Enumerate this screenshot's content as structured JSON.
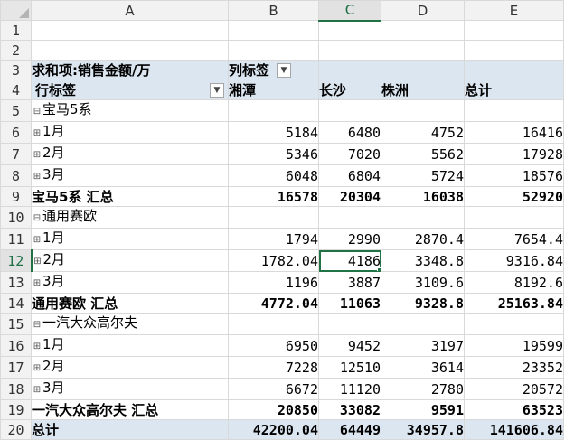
{
  "columns": [
    "A",
    "B",
    "C",
    "D",
    "E"
  ],
  "rows_numbers": [
    "1",
    "2",
    "3",
    "4",
    "5",
    "6",
    "7",
    "8",
    "9",
    "10",
    "11",
    "12",
    "13",
    "14",
    "15",
    "16",
    "17",
    "18",
    "19",
    "20"
  ],
  "pivot": {
    "value_label": "求和项:销售金额/万",
    "col_label": "列标签",
    "row_label": "行标签",
    "cities": [
      "湘潭",
      "长沙",
      "株洲"
    ],
    "total_label": "总计",
    "filter_icon": "dropdown-filter-icon",
    "groups": [
      {
        "name": "宝马5系",
        "toggle": "⊟",
        "months": [
          {
            "toggle": "⊞",
            "label": "1月",
            "v": [
              "5184",
              "6480",
              "4752",
              "16416"
            ]
          },
          {
            "toggle": "⊞",
            "label": "2月",
            "v": [
              "5346",
              "7020",
              "5562",
              "17928"
            ]
          },
          {
            "toggle": "⊞",
            "label": "3月",
            "v": [
              "6048",
              "6804",
              "5724",
              "18576"
            ]
          }
        ],
        "subtotal_label": "宝马5系 汇总",
        "subtotal": [
          "16578",
          "20304",
          "16038",
          "52920"
        ]
      },
      {
        "name": "通用赛欧",
        "toggle": "⊟",
        "months": [
          {
            "toggle": "⊞",
            "label": "1月",
            "v": [
              "1794",
              "2990",
              "2870.4",
              "7654.4"
            ]
          },
          {
            "toggle": "⊞",
            "label": "2月",
            "v": [
              "1782.04",
              "4186",
              "3348.8",
              "9316.84"
            ]
          },
          {
            "toggle": "⊞",
            "label": "3月",
            "v": [
              "1196",
              "3887",
              "3109.6",
              "8192.6"
            ]
          }
        ],
        "subtotal_label": "通用赛欧 汇总",
        "subtotal": [
          "4772.04",
          "11063",
          "9328.8",
          "25163.84"
        ]
      },
      {
        "name": "一汽大众高尔夫",
        "toggle": "⊟",
        "months": [
          {
            "toggle": "⊞",
            "label": "1月",
            "v": [
              "6950",
              "9452",
              "3197",
              "19599"
            ]
          },
          {
            "toggle": "⊞",
            "label": "2月",
            "v": [
              "7228",
              "12510",
              "3614",
              "23352"
            ]
          },
          {
            "toggle": "⊞",
            "label": "3月",
            "v": [
              "6672",
              "11120",
              "2780",
              "20572"
            ]
          }
        ],
        "subtotal_label": "一汽大众高尔夫 汇总",
        "subtotal": [
          "20850",
          "33082",
          "9591",
          "63523"
        ]
      }
    ],
    "grand_label": "总计",
    "grand": [
      "42200.04",
      "64449",
      "34957.8",
      "141606.84"
    ]
  },
  "selection": {
    "column": "C",
    "row": "12"
  }
}
